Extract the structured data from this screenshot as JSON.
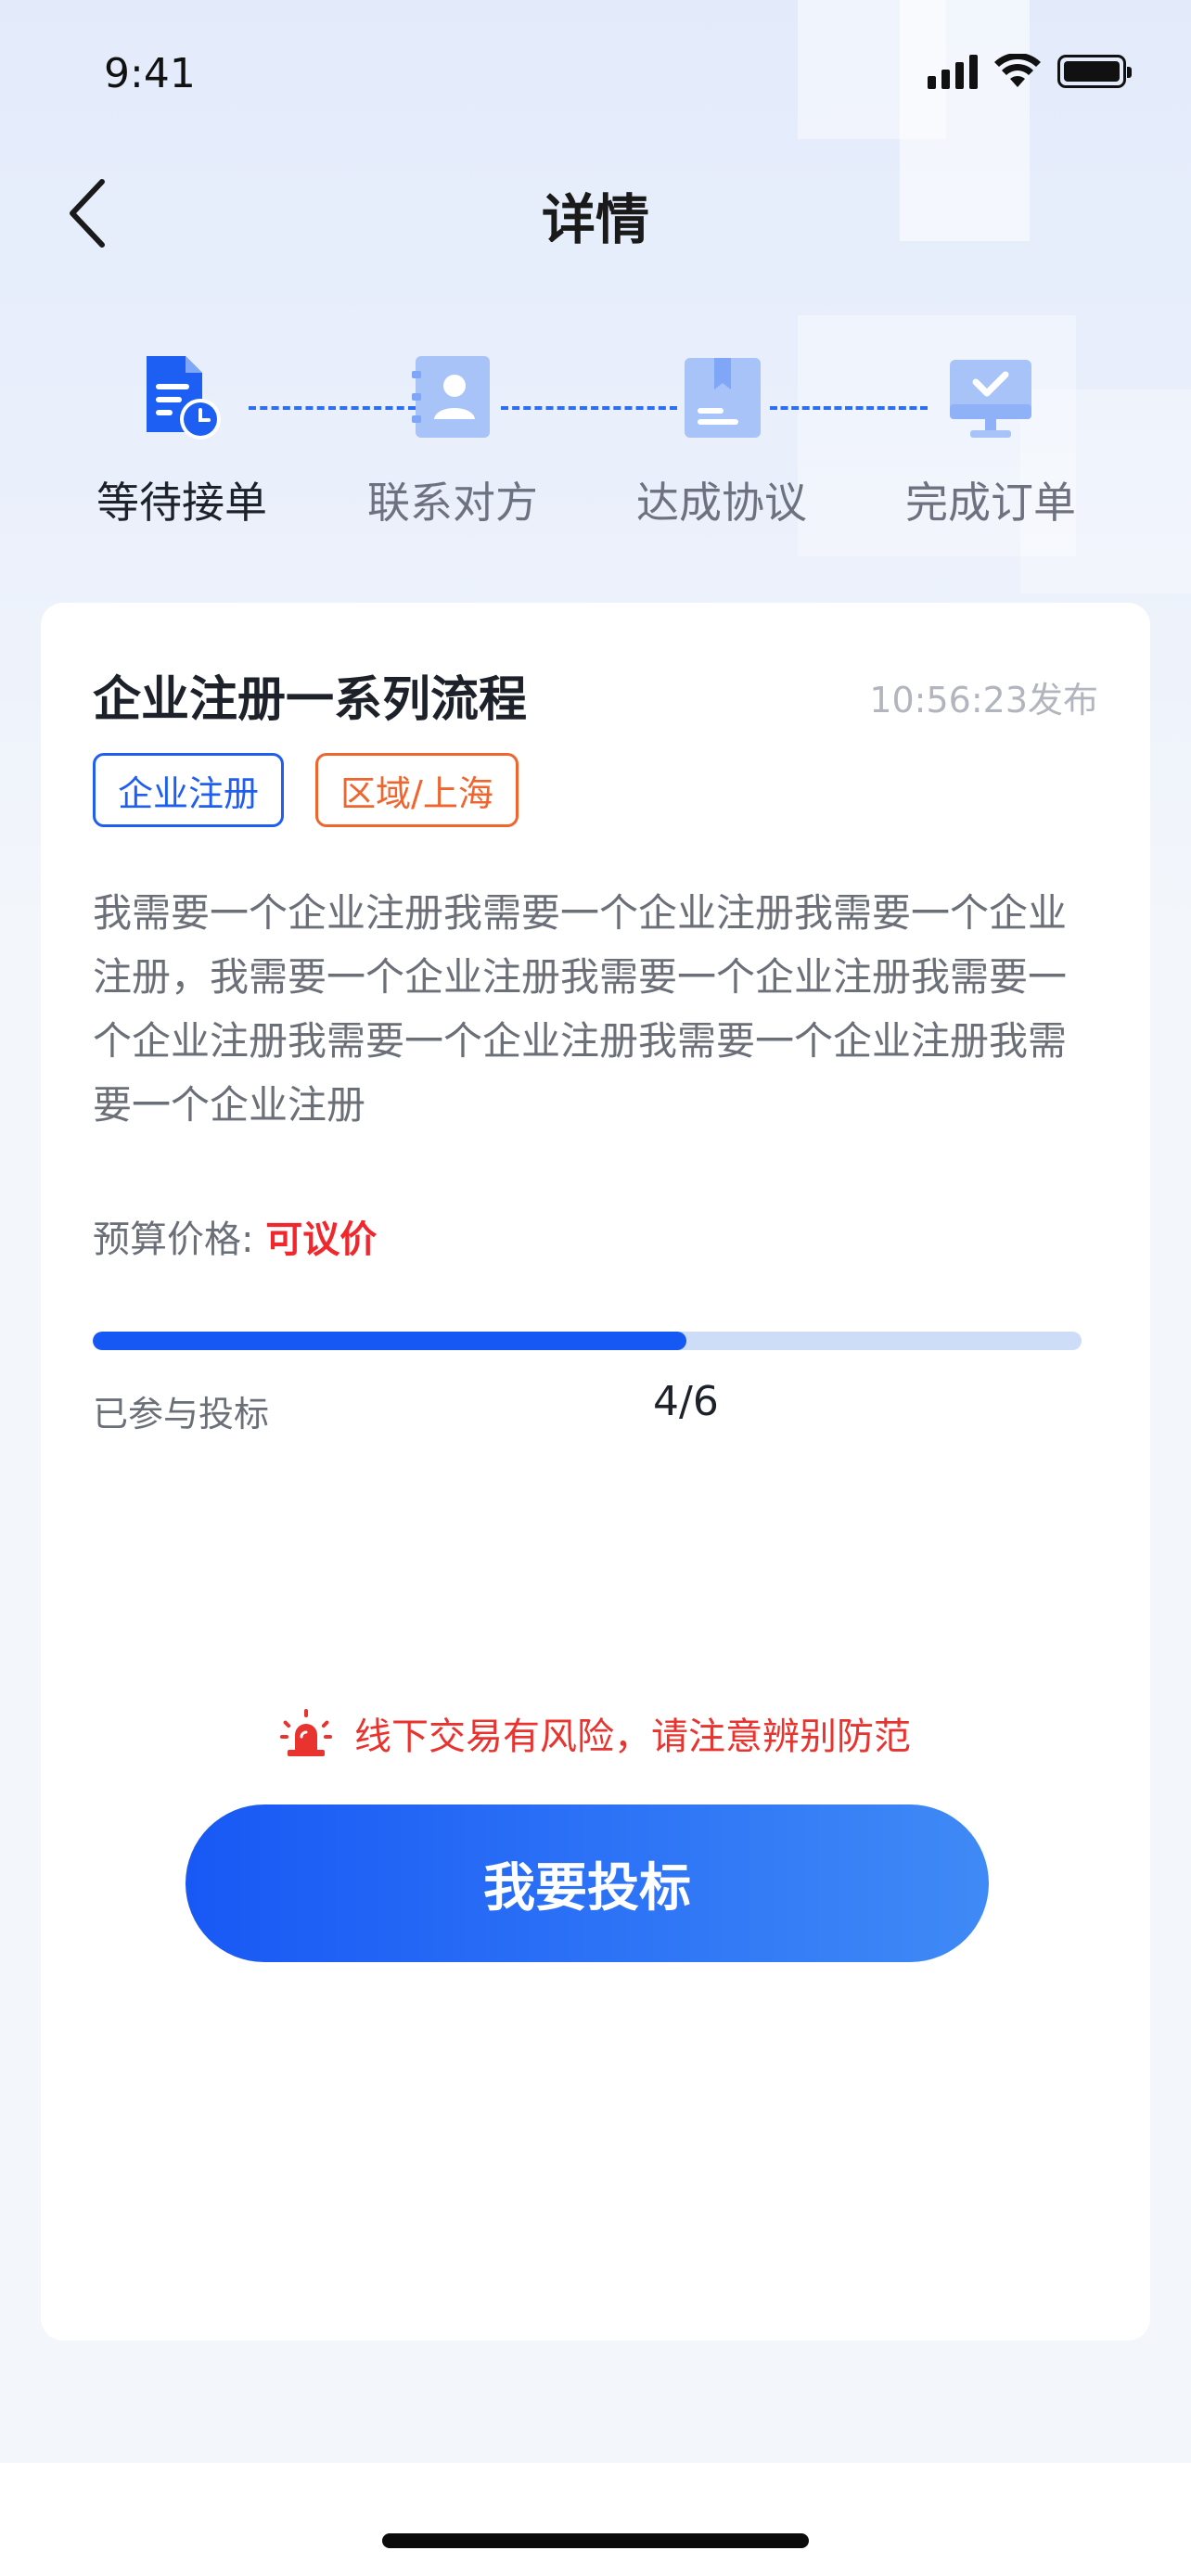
{
  "status_bar": {
    "time": "9:41"
  },
  "nav": {
    "title": "详情"
  },
  "steps": [
    {
      "label": "等待接单",
      "icon": "clipboard-clock-icon",
      "active": true
    },
    {
      "label": "联系对方",
      "icon": "contact-book-icon",
      "active": false
    },
    {
      "label": "达成协议",
      "icon": "agreement-book-icon",
      "active": false
    },
    {
      "label": "完成订单",
      "icon": "monitor-check-icon",
      "active": false
    }
  ],
  "card": {
    "title": "企业注册一系列流程",
    "time": "10:56:23发布",
    "tags": [
      {
        "label": "企业注册",
        "color": "#1f5ef0"
      },
      {
        "label": "区域/上海",
        "color": "#f0642d"
      }
    ],
    "description": "我需要一个企业注册我需要一个企业注册我需要一个企业注册，我需要一个企业注册我需要一个企业注册我需要一个企业注册我需要一个企业注册我需要一个企业注册我需要一个企业注册",
    "budget_label": "预算价格:",
    "budget_value": "可议价",
    "bid_label": "已参与投标",
    "bid_count": "4/6",
    "bid_progress": 0.6,
    "warning_icon": "alarm-light-icon",
    "warning": "线下交易有风险，请注意辨别防范",
    "cta_label": "我要投标"
  },
  "colors": {
    "accent": "#1558f3",
    "warning": "#e8332f",
    "tag_blue": "#1f5ef0",
    "tag_orange": "#f0642d"
  }
}
